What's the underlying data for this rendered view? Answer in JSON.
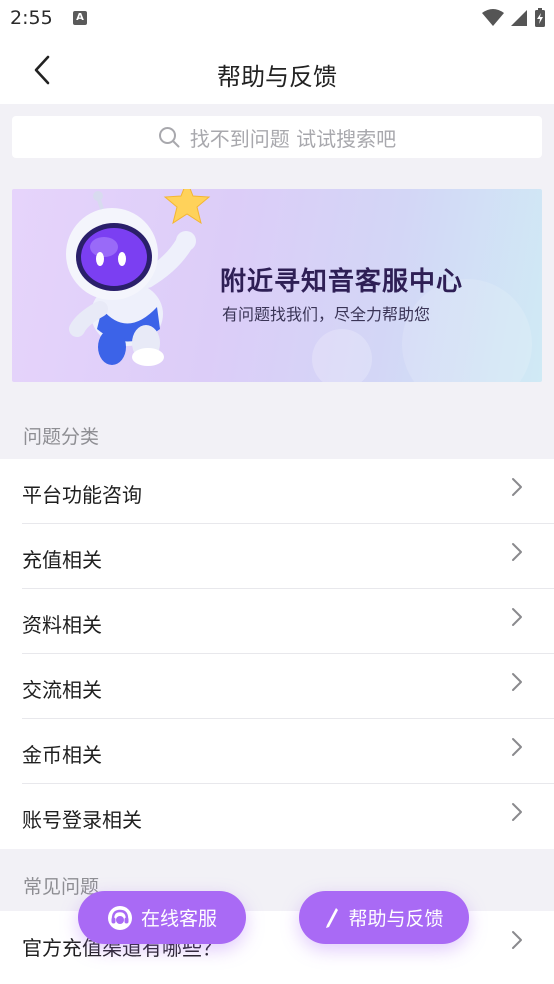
{
  "status_bar": {
    "time": "2:55",
    "notif_icon": "A"
  },
  "nav": {
    "title": "帮助与反馈"
  },
  "search": {
    "placeholder": "找不到问题 试试搜索吧"
  },
  "banner": {
    "title": "附近寻知音客服中心",
    "subtitle": "有问题找我们，尽全力帮助您"
  },
  "categories": {
    "header": "问题分类",
    "items": [
      {
        "label": "平台功能咨询"
      },
      {
        "label": "充值相关"
      },
      {
        "label": "资料相关"
      },
      {
        "label": "交流相关"
      },
      {
        "label": "金币相关"
      },
      {
        "label": "账号登录相关"
      }
    ]
  },
  "faq": {
    "header": "常见问题",
    "items": [
      {
        "label": "官方充值渠道有哪些？"
      }
    ]
  },
  "floating": {
    "service_label": "在线客服",
    "feedback_label": "帮助与反馈"
  },
  "colors": {
    "accent": "#a96af5",
    "background": "#f2f1f6"
  }
}
